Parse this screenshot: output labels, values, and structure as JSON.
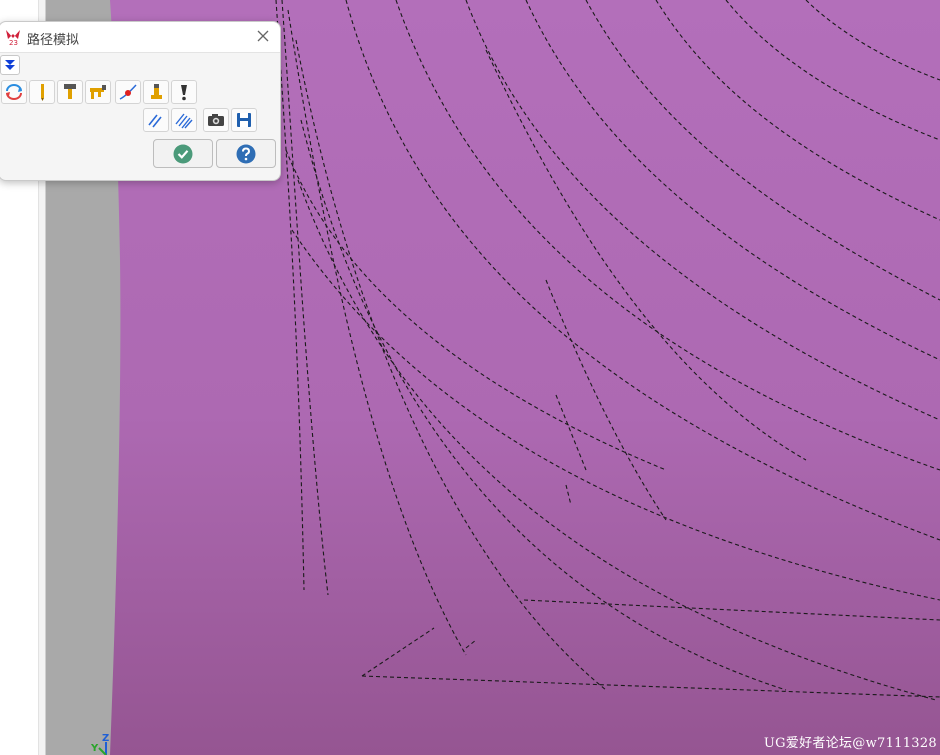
{
  "dialog": {
    "title": "路径模拟",
    "logo_text": "23",
    "toolbar_row1": [
      {
        "name": "simulate-backplot-icon"
      },
      {
        "name": "tool-display-icon"
      },
      {
        "name": "holder-display-icon"
      },
      {
        "name": "holder-fixture-icon"
      },
      {
        "name": "toolpath-point-icon"
      },
      {
        "name": "boot-tool-icon"
      },
      {
        "name": "info-icon"
      }
    ],
    "toolbar_row2": [
      {
        "name": "toolpath-lines-icon"
      },
      {
        "name": "toolpath-color-icon"
      },
      {
        "name": "screenshot-camera-icon"
      },
      {
        "name": "save-disk-icon"
      }
    ],
    "ok_icon": "check-icon",
    "help_icon": "help-icon"
  },
  "viewport": {
    "background_color": "#b26db7",
    "toolpath_color": "#1a1a1a"
  },
  "triad": {
    "z_label": "Z",
    "y_label": "Y"
  },
  "watermark": "UG爱好者论坛@w7111328"
}
